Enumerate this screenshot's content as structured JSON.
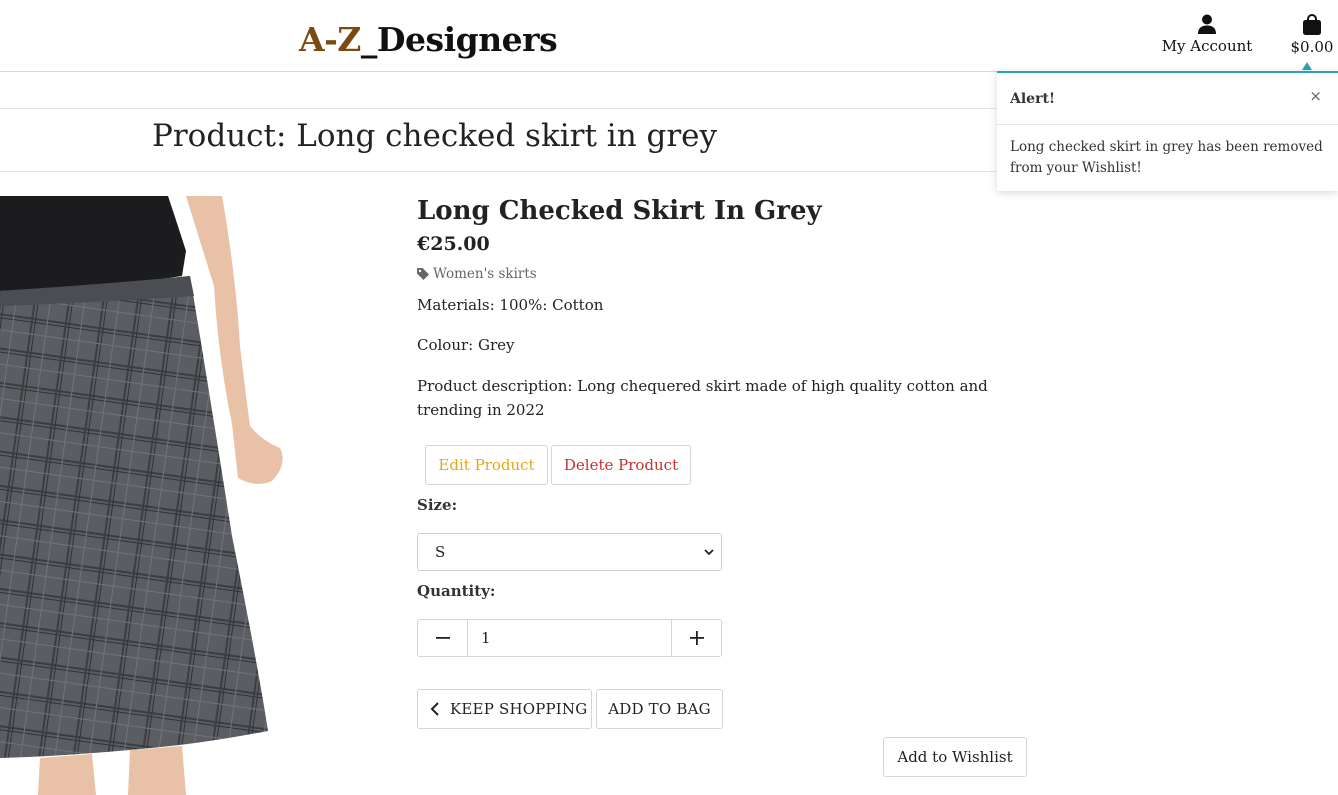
{
  "header": {
    "logo_brand": "A-Z",
    "logo_rest": "_Designers",
    "account_label": "My Account",
    "bag_total": "$0.00"
  },
  "page_title": "Product: Long checked skirt in grey",
  "product": {
    "name": "Long Checked Skirt In Grey",
    "price": "€25.00",
    "category": "Women's skirts",
    "materials": "Materials: 100%: Cotton",
    "colour": "Colour: Grey",
    "description": "Product description: Long chequered skirt made of high quality cotton and trending in 2022"
  },
  "admin": {
    "edit_label": "Edit Product",
    "delete_label": "Delete Product",
    "edit_color": "#e6a817",
    "delete_color": "#c9302c"
  },
  "form": {
    "size_label": "Size:",
    "size_value": "S",
    "quantity_label": "Quantity:",
    "quantity_value": "1"
  },
  "actions": {
    "keep_shopping": "Keep Shopping",
    "add_to_bag": "Add to Bag",
    "add_to_wishlist": "Add to Wishlist"
  },
  "toast": {
    "title": "Alert!",
    "close": "×",
    "message": "Long checked skirt in grey has been removed from your Wishlist!",
    "accent": "#2aa3b3"
  },
  "icons": {
    "account": "user-icon",
    "bag": "shopping-bag-icon",
    "category": "tag-icon",
    "minus": "minus-icon",
    "plus": "plus-icon",
    "back": "chevron-left-icon",
    "select": "chevron-down-icon"
  }
}
